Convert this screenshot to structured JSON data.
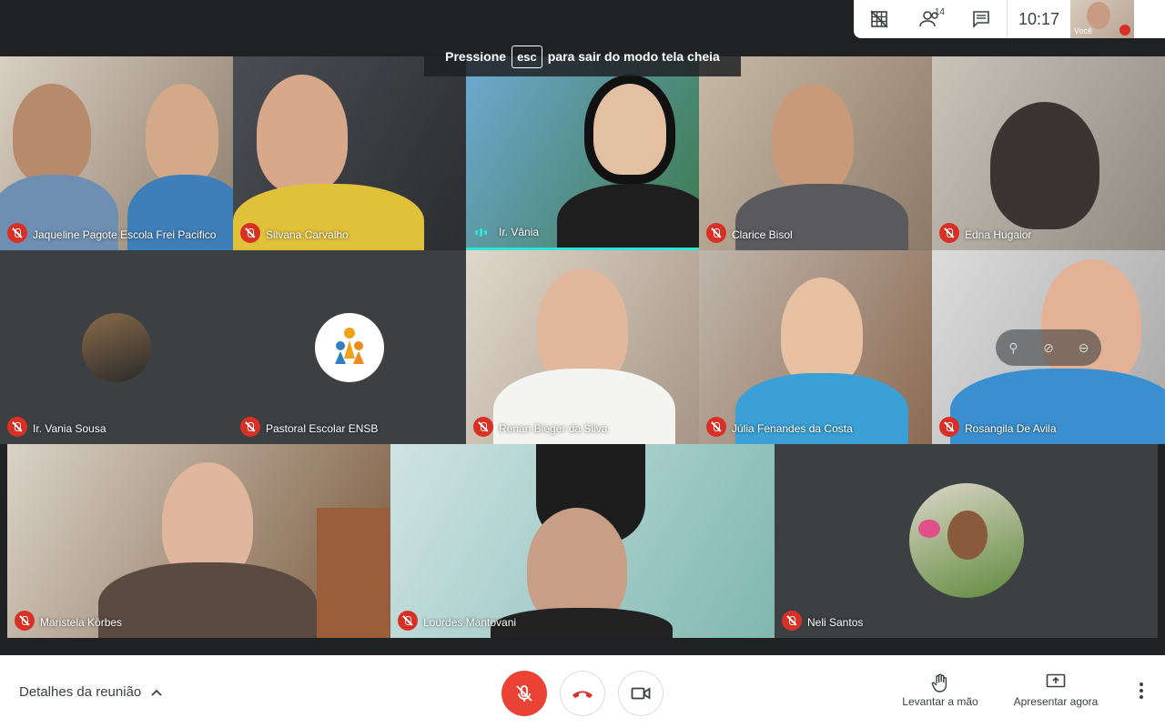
{
  "top_bar": {
    "participants_count": "14",
    "clock": "10:17",
    "self_label": "Você"
  },
  "toast": {
    "prefix": "Pressione",
    "key": "esc",
    "suffix": "para sair do modo tela cheia"
  },
  "participants": [
    {
      "name": "Jaqueline Pagote Escola Frei Pacifico"
    },
    {
      "name": "Silvana Carvalho"
    },
    {
      "name": "Ir. Vânia"
    },
    {
      "name": "Clarice Bisol"
    },
    {
      "name": "Edna Hugaior"
    },
    {
      "name": "Ir. Vania Sousa"
    },
    {
      "name": "Pastoral Escolar ENSB"
    },
    {
      "name": "Renan Bieger da Silva"
    },
    {
      "name": "Júlia Fenandes da Costa"
    },
    {
      "name": "Rosangila De Avila"
    },
    {
      "name": "Maristela Körbes"
    },
    {
      "name": "Lourdes Mantovani"
    },
    {
      "name": "Neli Santos"
    }
  ],
  "bottom_bar": {
    "details_label": "Detalhes da reunião",
    "raise_hand_label": "Levantar a mão",
    "present_label": "Apresentar agora"
  },
  "colors": {
    "background": "#202124",
    "mic_off": "#d93025",
    "speaking": "#2ee6d6"
  }
}
